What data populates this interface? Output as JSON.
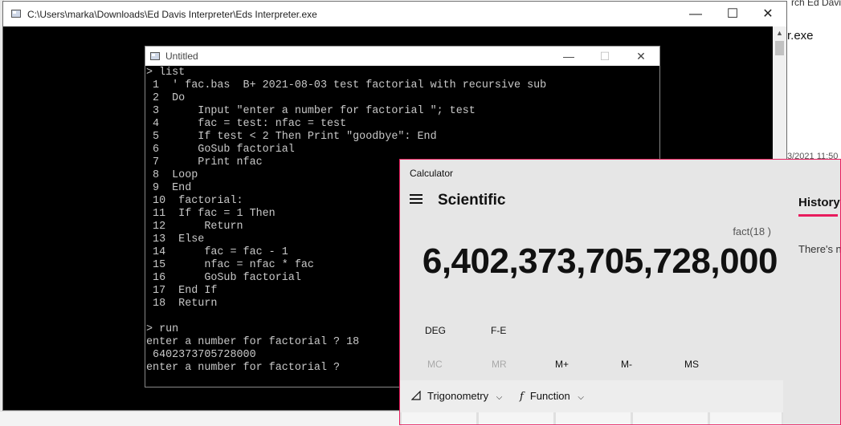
{
  "background": {
    "search_fragment": "rch Ed Davis",
    "exe_fragment": "r.exe",
    "date_fragment": "3/2021 11:50"
  },
  "interpreter": {
    "title": "C:\\Users\\marka\\Downloads\\Ed Davis Interpreter\\Eds Interpreter.exe",
    "minimize": "—",
    "maximize": "☐",
    "close": "✕"
  },
  "untitled": {
    "title": "Untitled",
    "minimize": "—",
    "maximize": "☐",
    "close": "✕"
  },
  "console_lines": [
    "> list",
    " 1  ' fac.bas  B+ 2021-08-03 test factorial with recursive sub",
    " 2  Do",
    " 3      Input \"enter a number for factorial \"; test",
    " 4      fac = test: nfac = test",
    " 5      If test < 2 Then Print \"goodbye\": End",
    " 6      GoSub factorial",
    " 7      Print nfac",
    " 8  Loop",
    " 9  End",
    " 10  factorial:",
    " 11  If fac = 1 Then",
    " 12      Return",
    " 13  Else",
    " 14      fac = fac - 1",
    " 15      nfac = nfac * fac",
    " 16      GoSub factorial",
    " 17  End If",
    " 18  Return",
    "",
    "> run",
    "enter a number for factorial ? 18",
    " 6402373705728000",
    "enter a number for factorial ?"
  ],
  "calculator": {
    "app_title": "Calculator",
    "mode": "Scientific",
    "expression": "fact(18 )",
    "display": "6,402,373,705,728,000",
    "deg": "DEG",
    "fe": "F-E",
    "memory": [
      "MC",
      "MR",
      "M+",
      "M-",
      "MS"
    ],
    "trig_label": "Trigonometry",
    "function_label": "Function",
    "history_tab": "History",
    "history_empty": "There's n",
    "accent": "#e81c5d"
  }
}
